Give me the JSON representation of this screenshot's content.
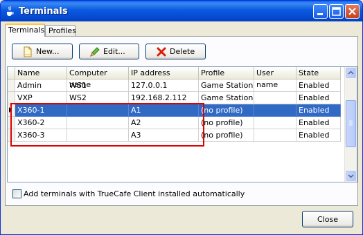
{
  "window": {
    "title": "Terminals",
    "app_icon": "java-cup-icon"
  },
  "tabs": [
    {
      "label": "Terminals",
      "active": true
    },
    {
      "label": "Profiles",
      "active": false
    }
  ],
  "toolbar": {
    "new_label": "New...",
    "edit_label": "Edit...",
    "delete_label": "Delete",
    "new_icon": "new-document-icon",
    "edit_icon": "pencil-icon",
    "delete_icon": "red-x-icon"
  },
  "table": {
    "columns": [
      "Name",
      "Computer name",
      "IP address",
      "Profile",
      "User name",
      "State"
    ],
    "rows": [
      {
        "name": "Admin",
        "computer": "WS1",
        "ip": "127.0.0.1",
        "profile": "Game Station",
        "user": "",
        "state": "Enabled",
        "selected": false
      },
      {
        "name": "VXP",
        "computer": "WS2",
        "ip": "192.168.2.112",
        "profile": "Game Station",
        "user": "",
        "state": "Enabled",
        "selected": false
      },
      {
        "name": "X360-1",
        "computer": "",
        "ip": "A1",
        "profile": "(no profile)",
        "user": "",
        "state": "Enabled",
        "selected": true
      },
      {
        "name": "X360-2",
        "computer": "",
        "ip": "A2",
        "profile": "(no profile)",
        "user": "",
        "state": "Enabled",
        "selected": false
      },
      {
        "name": "X360-3",
        "computer": "",
        "ip": "A3",
        "profile": "(no profile)",
        "user": "",
        "state": "Enabled",
        "selected": false
      }
    ]
  },
  "options": {
    "auto_add_label": "Add terminals with TrueCafe Client installed automatically",
    "auto_add_checked": false
  },
  "footer": {
    "close_label": "Close"
  },
  "colors": {
    "selection": "#316ac5",
    "highlight_box": "#e00000",
    "titlebar": "#0a5ae0"
  }
}
